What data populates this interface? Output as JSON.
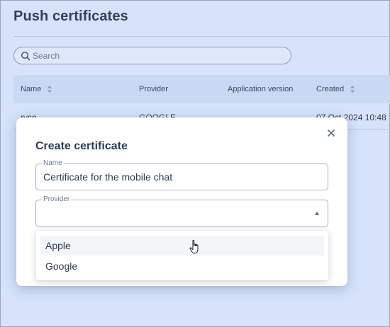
{
  "page": {
    "title": "Push certificates"
  },
  "search": {
    "placeholder": "Search"
  },
  "table": {
    "columns": [
      {
        "label": "Name",
        "sortable": true
      },
      {
        "label": "Provider",
        "sortable": false
      },
      {
        "label": "Application version",
        "sortable": false
      },
      {
        "label": "Created",
        "sortable": true
      }
    ],
    "rows": [
      {
        "name": "rysp",
        "provider": "GOOGLE",
        "version": "—",
        "created": "07 Oct 2024 10:48"
      }
    ]
  },
  "modal": {
    "title": "Create certificate",
    "name_field": {
      "label": "Name",
      "value": "Certificate for the mobile chat"
    },
    "provider_field": {
      "label": "Provider",
      "value": ""
    },
    "provider_options": [
      "Apple",
      "Google"
    ]
  },
  "colors": {
    "background": "#d6e3fb",
    "table_header": "#c9d8f3",
    "modal": "#ffffff",
    "hover": "#f3f5f9"
  }
}
